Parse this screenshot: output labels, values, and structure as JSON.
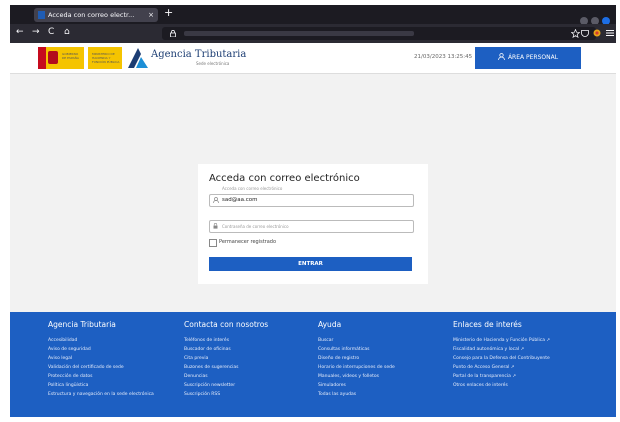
{
  "browser": {
    "tab_title": "Acceda con correo electr...",
    "tab_close": "×",
    "new_tab": "+",
    "nav": {
      "back": "←",
      "forward": "→",
      "reload": "C",
      "home": "⌂"
    }
  },
  "header": {
    "ministry_line1": "GOBIERNO",
    "ministry_line2": "DE ESPAÑA",
    "ministry_line3": "MINISTERIO DE HACIENDA Y FUNCIÓN PÚBLICA",
    "brand": "Agencia Tributaria",
    "brand_sub": "Sede electrónica",
    "datetime": "21/03/2023 13:25:45",
    "area_button": "ÁREA PERSONAL"
  },
  "login": {
    "title": "Acceda con correo electrónico",
    "email_float_label": "Acceda con correo electrónico",
    "email_value": "sad@aa.com",
    "password_placeholder": "Contraseña de correo electrónico",
    "remember_label": "Permanecer registrado",
    "submit_label": "ENTRAR"
  },
  "footer": {
    "columns": [
      {
        "title": "Agencia Tributaria",
        "links": [
          "Accesibilidad",
          "Aviso de seguridad",
          "Aviso legal",
          "Validación del certificado de sede",
          "Protección de datos",
          "Política lingüística",
          "Estructura y navegación en la sede electrónica"
        ]
      },
      {
        "title": "Contacta con nosotros",
        "links": [
          "Teléfonos de interés",
          "Buscador de oficinas",
          "Cita previa",
          "Buzones de sugerencias",
          "Denuncias",
          "Suscripción newsletter",
          "Suscripción RSS"
        ]
      },
      {
        "title": "Ayuda",
        "links": [
          "Buscar",
          "Consultas informáticas",
          "Diseño de registro",
          "Horario de interrupciones de sede",
          "Manuales, vídeos y folletos",
          "Simuladores",
          "Todas las ayudas"
        ]
      },
      {
        "title": "Enlaces de interés",
        "links": [
          "Ministerio de Hacienda y Función Pública ↗",
          "Fiscalidad autonómica y local ↗",
          "Consejo para la Defensa del Contribuyente",
          "Punto de Acceso General ↗",
          "Portal de la transparencia ↗",
          "Otros enlaces de interés"
        ]
      }
    ]
  },
  "colors": {
    "primary": "#1d5fc2",
    "page_bg": "#f2f2f2",
    "browser_chrome": "#2b2a33"
  }
}
